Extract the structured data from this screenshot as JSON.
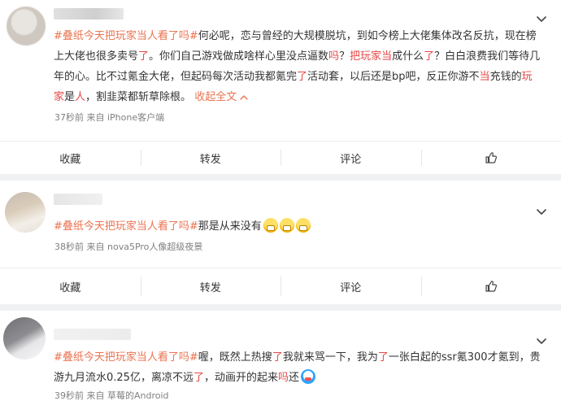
{
  "posts": [
    {
      "text_parts": [
        {
          "type": "hashtag",
          "text": "#叠纸今天把玩家当人看了吗#"
        },
        {
          "type": "text",
          "text": "何必呢，恋与曾经的大规模脱坑，到如今榜上大佬集体改名反抗，现在榜上大佬也很多卖号"
        },
        {
          "type": "red",
          "text": "了"
        },
        {
          "type": "text",
          "text": "。你们自己游戏做成啥样心里没点逼数"
        },
        {
          "type": "red",
          "text": "吗"
        },
        {
          "type": "text",
          "text": "？"
        },
        {
          "type": "red",
          "text": "把玩家当"
        },
        {
          "type": "text",
          "text": "成什么"
        },
        {
          "type": "red",
          "text": "了"
        },
        {
          "type": "text",
          "text": "？白白浪费我们等待几年的心。比不过氪金大佬，但起码每次活动我都氪完"
        },
        {
          "type": "red",
          "text": "了"
        },
        {
          "type": "text",
          "text": "活动套，以后还是bp吧，反正你游不"
        },
        {
          "type": "red",
          "text": "当"
        },
        {
          "type": "text",
          "text": "充钱的"
        },
        {
          "type": "red",
          "text": "玩家"
        },
        {
          "type": "text",
          "text": "是"
        },
        {
          "type": "red",
          "text": "人"
        },
        {
          "type": "text",
          "text": "，割韭菜都斩草除根。 "
        }
      ],
      "collapse_label": "收起全文",
      "meta": "37秒前  来自 iPhone客户端",
      "actions": {
        "collect": "收藏",
        "forward": "转发",
        "comment": "评论"
      }
    },
    {
      "text_parts": [
        {
          "type": "hashtag",
          "text": "#叠纸今天把玩家当人看了吗#"
        },
        {
          "type": "text",
          "text": "那是从来没有"
        }
      ],
      "emoji_count": 3,
      "meta": "38秒前  来自 nova5Pro人像超级夜景",
      "actions": {
        "collect": "收藏",
        "forward": "转发",
        "comment": "评论"
      }
    },
    {
      "text_parts": [
        {
          "type": "hashtag",
          "text": "#叠纸今天把玩家当人看了吗#"
        },
        {
          "type": "text",
          "text": "喔，既然上热搜"
        },
        {
          "type": "red",
          "text": "了"
        },
        {
          "type": "text",
          "text": "我就来骂一下，我为"
        },
        {
          "type": "red",
          "text": "了"
        },
        {
          "type": "text",
          "text": "一张白起的ssr氪300才氪到，贵游九月流水0.25亿，离凉不远"
        },
        {
          "type": "red",
          "text": "了"
        },
        {
          "type": "text",
          "text": "，动画开的起来"
        },
        {
          "type": "red",
          "text": "吗"
        },
        {
          "type": "text",
          "text": "还"
        }
      ],
      "meta": "39秒前  来自 草莓的Android"
    }
  ],
  "icons": {
    "chevron": "chevron-down-icon",
    "like": "thumbs-up-icon",
    "emoji_grin": "grinning-emoji-icon",
    "emoji_doraemon": "doraemon-emoji-icon"
  },
  "colors": {
    "hashtag": "#eb7350",
    "highlight": "#e64545",
    "meta": "#808080",
    "background": "#f0f1f2"
  }
}
